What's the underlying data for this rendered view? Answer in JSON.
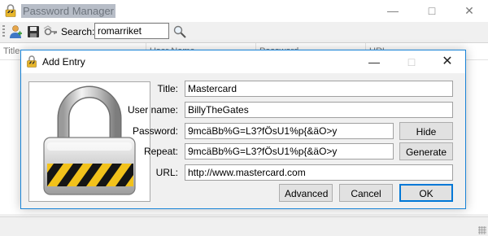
{
  "main": {
    "title": "Password Manager",
    "toolbar": {
      "search_label": "Search:",
      "search_value": "romarriket"
    },
    "columns": [
      "Title",
      "User Name",
      "Password",
      "URL"
    ]
  },
  "dialog": {
    "title": "Add Entry",
    "fields": {
      "title_label": "Title:",
      "title_value": "Mastercard",
      "username_label": "User name:",
      "username_value": "BillyTheGates",
      "password_label": "Password:",
      "password_value": "9mcäBb%G=L3?fÖsU1%p{&äO>y",
      "repeat_label": "Repeat:",
      "repeat_value": "9mcäBb%G=L3?fÖsU1%p{&äO>y",
      "url_label": "URL:",
      "url_value": "http://www.mastercard.com"
    },
    "buttons": {
      "hide": "Hide",
      "generate": "Generate",
      "advanced": "Advanced",
      "cancel": "Cancel",
      "ok": "OK"
    }
  },
  "colors": {
    "accent": "#0078d7",
    "dialog_border": "#1883d7",
    "title_highlight": "#b7bdc7"
  },
  "icons": [
    "lock-icon",
    "user-add-icon",
    "save-icon",
    "keys-icon",
    "magnifier-icon"
  ]
}
